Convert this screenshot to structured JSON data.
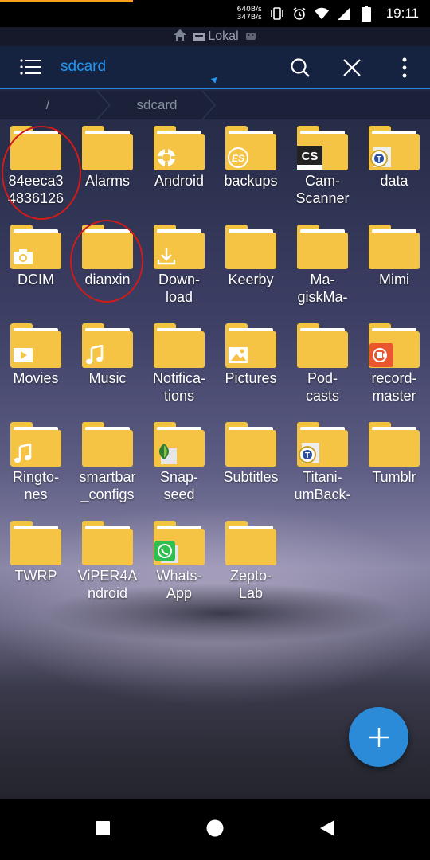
{
  "status": {
    "download_progress": 0.31,
    "net_up": "640B/s",
    "net_down": "347B/s",
    "time": "19:11",
    "icons": [
      "vibrate-icon",
      "alarm-icon",
      "wifi-icon",
      "signal-icon",
      "battery-icon"
    ]
  },
  "lokal": {
    "label": "Lokal",
    "icons": [
      "home-icon",
      "storage-icon",
      "android-icon"
    ]
  },
  "toolbar": {
    "title": "sdcard",
    "icons": [
      "menu-icon",
      "search-icon",
      "close-icon",
      "more-vert-icon"
    ]
  },
  "breadcrumb": {
    "items": [
      "/",
      "sdcard"
    ]
  },
  "folders": [
    {
      "name": "84eeca3\n4836126",
      "badge": ""
    },
    {
      "name": "Alarms",
      "badge": ""
    },
    {
      "name": "Android",
      "badge": "gear-icon"
    },
    {
      "name": "backups",
      "badge": "es-icon"
    },
    {
      "name": "Cam-\nScanner",
      "badge": "camscanner-icon"
    },
    {
      "name": "data",
      "badge": "titanium-icon"
    },
    {
      "name": "DCIM",
      "badge": "camera-icon"
    },
    {
      "name": "dianxin",
      "badge": ""
    },
    {
      "name": "Down-\nload",
      "badge": "download-icon"
    },
    {
      "name": "Keerby",
      "badge": ""
    },
    {
      "name": "Ma-\ngiskMa-",
      "badge": ""
    },
    {
      "name": "Mimi",
      "badge": ""
    },
    {
      "name": "Movies",
      "badge": "play-icon"
    },
    {
      "name": "Music",
      "badge": "music-icon"
    },
    {
      "name": "Notifica-\ntions",
      "badge": ""
    },
    {
      "name": "Pictures",
      "badge": "image-icon"
    },
    {
      "name": "Pod-\ncasts",
      "badge": ""
    },
    {
      "name": "record-\nmaster",
      "badge": "recorder-icon"
    },
    {
      "name": "Ringto-\nnes",
      "badge": "music-icon"
    },
    {
      "name": "smartbar\n_configs",
      "badge": ""
    },
    {
      "name": "Snap-\nseed",
      "badge": "snapseed-icon"
    },
    {
      "name": "Subtitles",
      "badge": ""
    },
    {
      "name": "Titani-\numBack-",
      "badge": "titanium-icon"
    },
    {
      "name": "Tumblr",
      "badge": ""
    },
    {
      "name": "TWRP",
      "badge": ""
    },
    {
      "name": "ViPER4A\nndroid",
      "badge": ""
    },
    {
      "name": "Whats-\nApp",
      "badge": "whatsapp-icon"
    },
    {
      "name": "Zepto-\nLab",
      "badge": ""
    }
  ],
  "highlighted_folders": [
    "84eeca3\n4836126",
    "dianxin"
  ],
  "fab": {
    "icon": "plus-icon"
  },
  "navbar": {
    "icons": [
      "recents-icon",
      "home-icon",
      "back-icon"
    ]
  },
  "colors": {
    "accent": "#2196f3",
    "folder": "#f6c444",
    "toolbar": "#152240",
    "fab": "#2b8bd8",
    "annotation": "#d11a1a"
  }
}
